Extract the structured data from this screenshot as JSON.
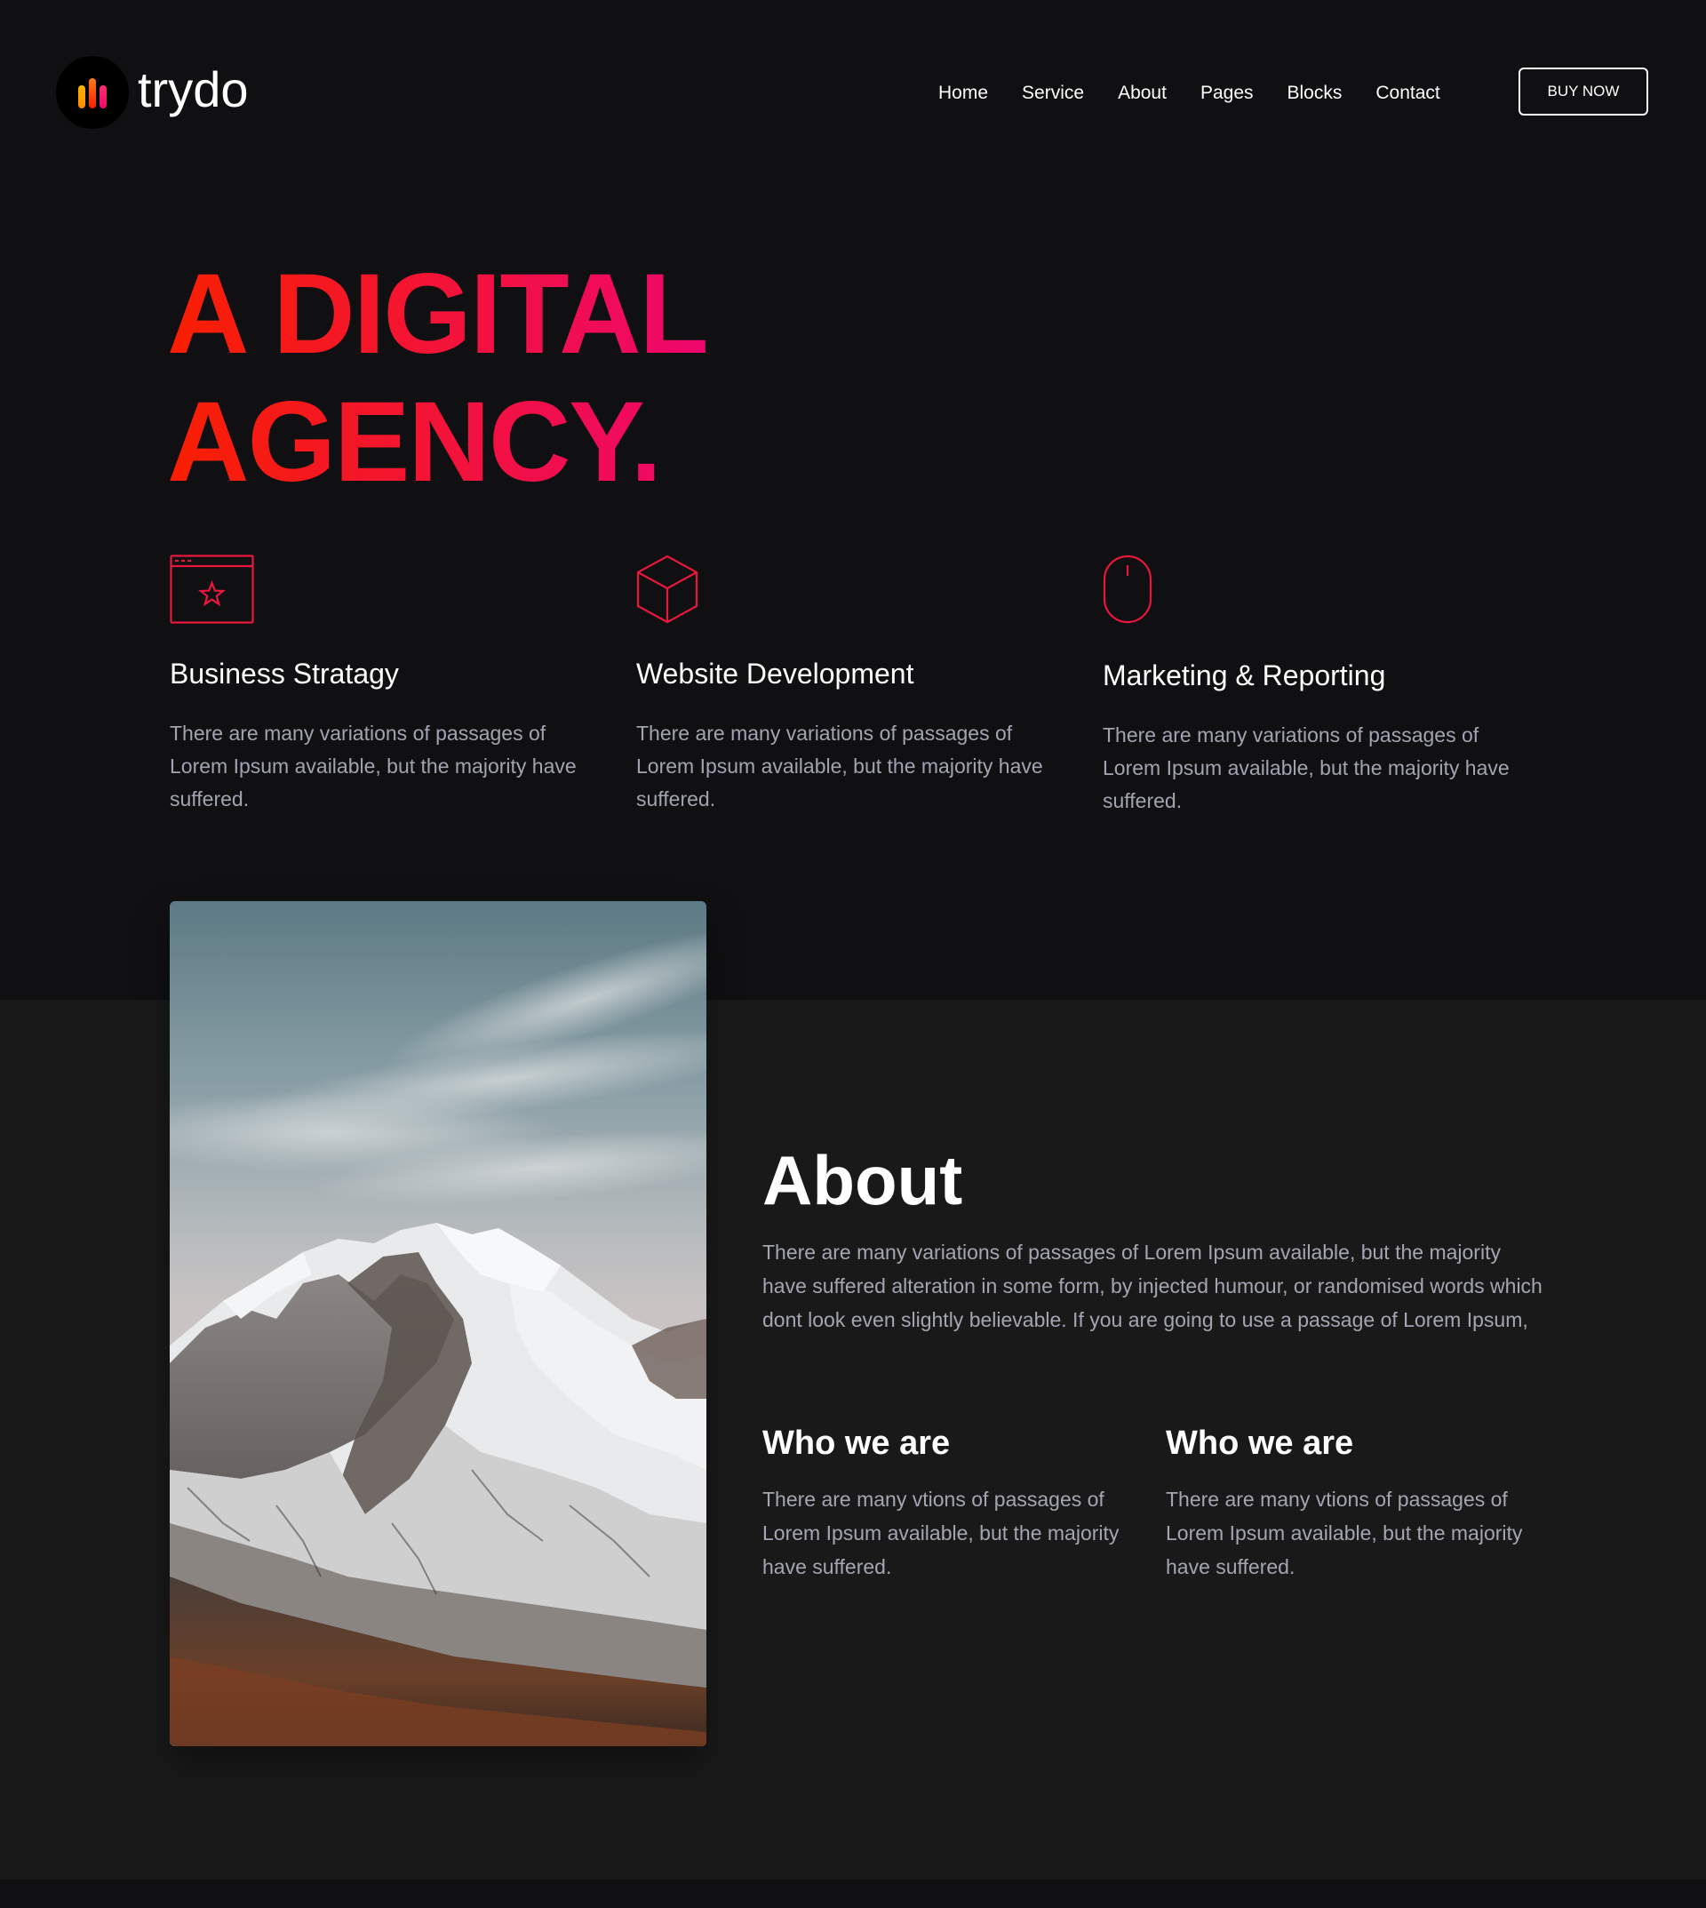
{
  "brand": {
    "name": "trydo",
    "accent_start": "#f81f01",
    "accent_end": "#ee076e"
  },
  "nav": {
    "items": [
      {
        "label": "Home"
      },
      {
        "label": "Service"
      },
      {
        "label": "About"
      },
      {
        "label": "Pages"
      },
      {
        "label": "Blocks"
      },
      {
        "label": "Contact"
      }
    ],
    "cta_label": "BUY NOW"
  },
  "hero": {
    "line1": "A DIGITAL",
    "line2": "AGENCY."
  },
  "services": [
    {
      "icon": "browser-star-icon",
      "title": "Business Stratagy",
      "description": "There are many variations of passages of Lorem Ipsum available, but the majority have suffered."
    },
    {
      "icon": "cube-icon",
      "title": "Website Development",
      "description": "There are many variations of passages of Lorem Ipsum available, but the majority have suffered."
    },
    {
      "icon": "mouse-icon",
      "title": "Marketing & Reporting",
      "description": "There are many variations of passages of Lorem Ipsum available, but the majority have suffered."
    }
  ],
  "about": {
    "title": "About",
    "description": "There are many variations of passages of Lorem Ipsum available, but the majority have suffered alteration in some form, by injected humour, or randomised words which dont look even slightly believable. If you are going to use a passage of Lorem Ipsum,",
    "image": "snowy-mountain-photo",
    "columns": [
      {
        "title": "Who we are",
        "description": "There are many vtions of passages of Lorem Ipsum available, but the majority have suffered."
      },
      {
        "title": "Who we are",
        "description": "There are many vtions of passages of Lorem Ipsum available, but the majority have suffered."
      }
    ]
  }
}
